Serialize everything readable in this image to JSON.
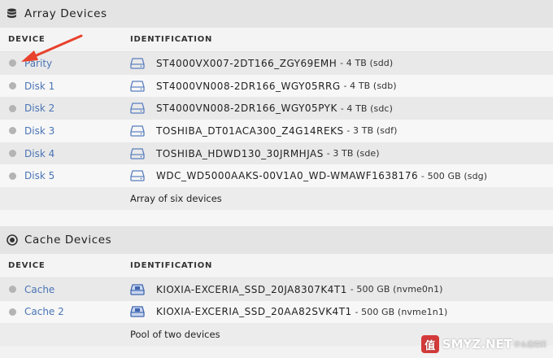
{
  "array": {
    "title": "Array Devices",
    "col_device": "DEVICE",
    "col_ident": "IDENTIFICATION",
    "rows": [
      {
        "device": "Parity",
        "name": "ST4000VX007-2DT166_ZGY69EMH",
        "size": "- 4 TB (sdd)"
      },
      {
        "device": "Disk 1",
        "name": "ST4000VN008-2DR166_WGY05RRG",
        "size": "- 4 TB (sdb)"
      },
      {
        "device": "Disk 2",
        "name": "ST4000VN008-2DR166_WGY05PYK",
        "size": "- 4 TB (sdc)"
      },
      {
        "device": "Disk 3",
        "name": "TOSHIBA_DT01ACA300_Z4G14REKS",
        "size": "- 3 TB (sdf)"
      },
      {
        "device": "Disk 4",
        "name": "TOSHIBA_HDWD130_30JRMHJAS",
        "size": "- 3 TB (sde)"
      },
      {
        "device": "Disk 5",
        "name": "WDC_WD5000AAKS-00V1A0_WD-WMAWF1638176",
        "size": "- 500 GB (sdg)"
      }
    ],
    "summary": "Array of six devices"
  },
  "cache": {
    "title": "Cache Devices",
    "col_device": "DEVICE",
    "col_ident": "IDENTIFICATION",
    "rows": [
      {
        "device": "Cache",
        "name": "KIOXIA-EXCERIA_SSD_20JA8307K4T1",
        "size": "- 500 GB (nvme0n1)"
      },
      {
        "device": "Cache 2",
        "name": "KIOXIA-EXCERIA_SSD_20AA82SVK4T1",
        "size": "- 500 GB (nvme1n1)"
      }
    ],
    "summary": "Pool of two devices"
  },
  "watermark": {
    "badge": "值",
    "text": "SMYZ.NET",
    "sub": "什么值得买"
  },
  "colors": {
    "link": "#4a74b6",
    "arrow": "#e8412c",
    "status_dot": "#b4b4b4",
    "hdd_icon": "#5a7fc0",
    "ssd_icon": "#3f66b0"
  },
  "icons": {
    "array": "database-icon",
    "cache": "target-icon",
    "hdd": "hdd-icon",
    "ssd": "ssd-icon"
  }
}
